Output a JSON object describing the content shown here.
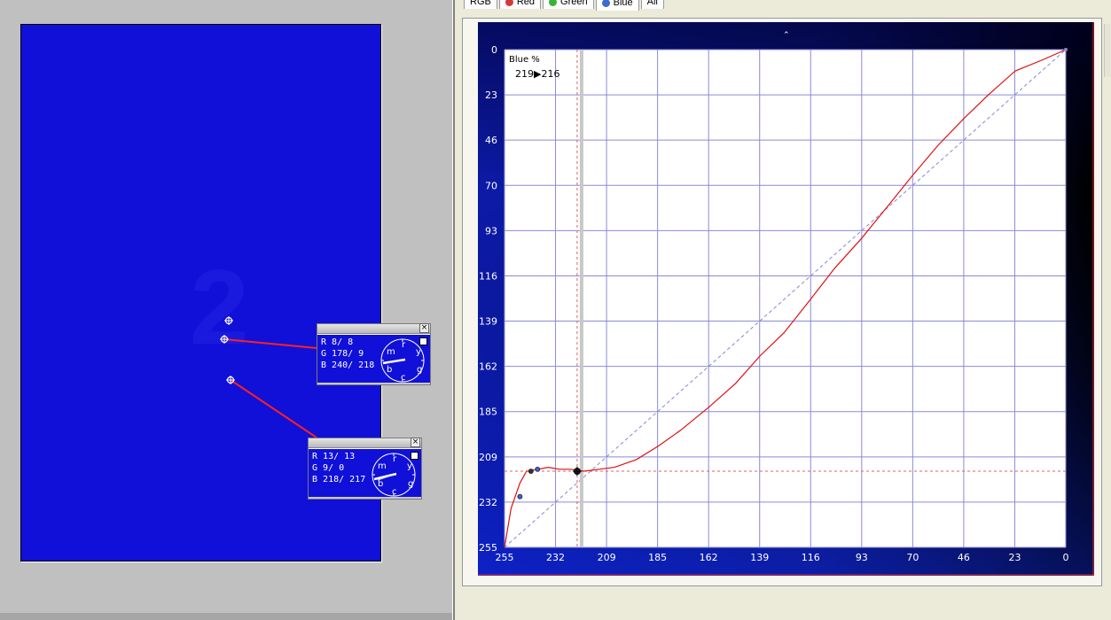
{
  "tabs": [
    {
      "label": "RGB",
      "dot": "",
      "active": false
    },
    {
      "label": "Red",
      "dot": "#d23a3a",
      "active": false
    },
    {
      "label": "Green",
      "dot": "#3ab23a",
      "active": false
    },
    {
      "label": "Blue",
      "dot": "#3a6ad2",
      "active": true
    },
    {
      "label": "All",
      "dot": "",
      "active": false
    }
  ],
  "canvas": {
    "digit": "2",
    "color": "#1010d8"
  },
  "probes": [
    {
      "r": [
        "8",
        "8"
      ],
      "g": [
        "178",
        "9"
      ],
      "b": [
        "240",
        "218"
      ],
      "close": "×"
    },
    {
      "r": [
        "13",
        "13"
      ],
      "g": [
        "9",
        "0"
      ],
      "b": [
        "218",
        "217"
      ],
      "close": "×"
    }
  ],
  "dial_letters": [
    "m",
    "r",
    "y",
    "b",
    "c",
    "g"
  ],
  "chart_data": {
    "type": "line",
    "channel_label": "Blue %",
    "readout_in": "219",
    "readout_arrow": "▶",
    "readout_out": "216",
    "x_ticks": [
      "255",
      "232",
      "209",
      "185",
      "162",
      "139",
      "116",
      "93",
      "70",
      "46",
      "23",
      "0"
    ],
    "y_ticks": [
      "0",
      "23",
      "46",
      "70",
      "93",
      "116",
      "139",
      "162",
      "185",
      "209",
      "232",
      "255"
    ],
    "xlim": [
      255,
      0
    ],
    "ylim": [
      0,
      255
    ],
    "grid": true,
    "curve_color": "#e01010",
    "grid_color": "#8a8ad8",
    "series": [
      {
        "points": [
          [
            255,
            255
          ],
          [
            252,
            235
          ],
          [
            248,
            222
          ],
          [
            245,
            216
          ],
          [
            240,
            215
          ],
          [
            235,
            214
          ],
          [
            230,
            215
          ],
          [
            225,
            215
          ],
          [
            219,
            216
          ],
          [
            212,
            215
          ],
          [
            205,
            214
          ],
          [
            195,
            210
          ],
          [
            185,
            203
          ],
          [
            175,
            195
          ],
          [
            162,
            183
          ],
          [
            150,
            171
          ],
          [
            139,
            157
          ],
          [
            128,
            145
          ],
          [
            116,
            128
          ],
          [
            105,
            112
          ],
          [
            93,
            97
          ],
          [
            80,
            79
          ],
          [
            70,
            65
          ],
          [
            58,
            49
          ],
          [
            46,
            35
          ],
          [
            35,
            23
          ],
          [
            23,
            11
          ],
          [
            10,
            5
          ],
          [
            0,
            0
          ]
        ]
      }
    ],
    "diagonal": [
      [
        255,
        255
      ],
      [
        0,
        0
      ]
    ],
    "control_points": [
      [
        248,
        229
      ],
      [
        243,
        216
      ],
      [
        240,
        215
      ],
      [
        222,
        216
      ]
    ],
    "selected_input": 222,
    "selected_output": 216
  }
}
